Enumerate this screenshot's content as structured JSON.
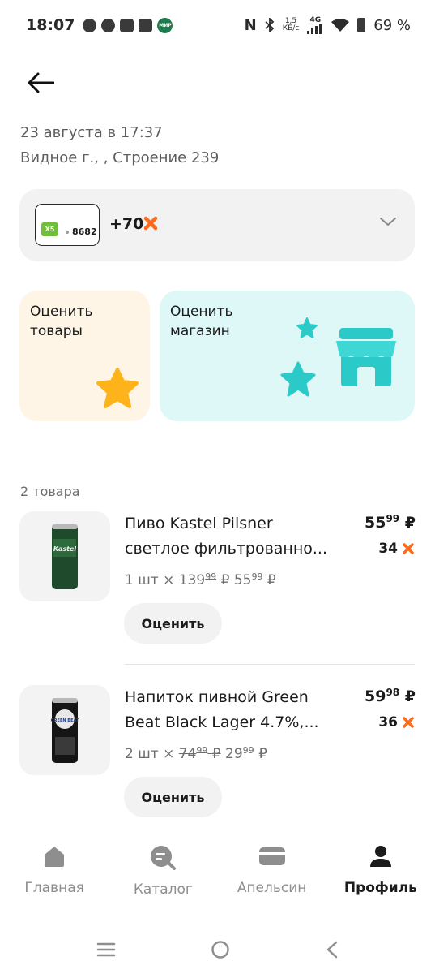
{
  "status_bar": {
    "time": "18:07",
    "network_speed_value": "1,5",
    "network_speed_unit": "КБ/с",
    "network_type": "4G",
    "battery": "69 %",
    "mir_label": "МИР"
  },
  "order": {
    "date": "23 августа в 17:37",
    "address": "Видное г., , Строение 239"
  },
  "bonus": {
    "card_brand": "X5",
    "card_number": "8682",
    "points": "+70"
  },
  "rating": {
    "goods_title_line1": "Оценить",
    "goods_title_line2": "товары",
    "shop_title_line1": "Оценить",
    "shop_title_line2": "магазин"
  },
  "items_count": "2 товара",
  "products": [
    {
      "name_line1": "Пиво Kastel Pilsner",
      "name_line2": "светлое фильтрованно...",
      "price_main": "55",
      "price_kop": "99",
      "currency": "₽",
      "points": "34",
      "qty": "1 шт ×",
      "old_price_main": "139",
      "old_price_kop": "99",
      "unit_price_main": "55",
      "unit_price_kop": "99",
      "rate_label": "Оценить",
      "can_label": "Kastel"
    },
    {
      "name_line1": "Напиток пивной Green",
      "name_line2": "Beat Black Lager 4.7%,...",
      "price_main": "59",
      "price_kop": "98",
      "currency": "₽",
      "points": "36",
      "qty": "2 шт ×",
      "old_price_main": "74",
      "old_price_kop": "99",
      "unit_price_main": "29",
      "unit_price_kop": "99",
      "rate_label": "Оценить",
      "can_label": "GREEN BEAT"
    }
  ],
  "bottom_nav": [
    {
      "label": "Главная",
      "icon": "home-icon",
      "active": false
    },
    {
      "label": "Каталог",
      "icon": "catalog-search-icon",
      "active": false
    },
    {
      "label": "Апельсин",
      "icon": "card-icon",
      "active": false
    },
    {
      "label": "Профиль",
      "icon": "profile-icon",
      "active": true
    }
  ],
  "colors": {
    "accent_orange": "#ff6b1a",
    "star_yellow": "#ffb31a",
    "teal": "#2cc9c9",
    "card_green": "#6fbf3a"
  }
}
